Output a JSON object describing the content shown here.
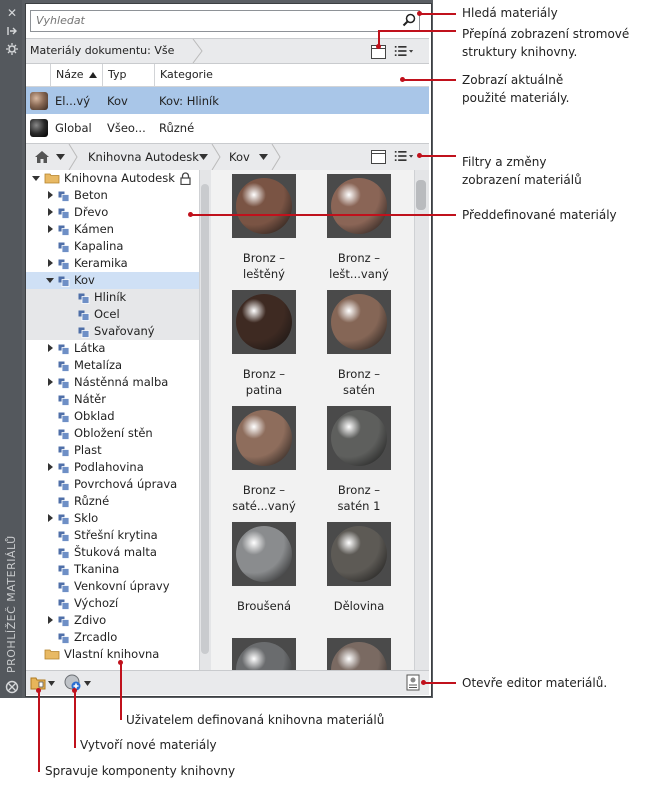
{
  "palette": {
    "vertical_title": "PROHLÍŽEČ MATERIÁLŮ",
    "search": {
      "placeholder": "Vyhledat"
    },
    "document_bar": {
      "breadcrumb": "Materiály dokumentu: Vše"
    },
    "table": {
      "headers": [
        "Náze",
        "Typ",
        "Kategorie"
      ],
      "sort_indicator": "ascending",
      "rows": [
        {
          "name": "El...vý",
          "type": "Kov",
          "category": "Kov: Hliník",
          "selected": true,
          "swatch": "#8a6a55"
        },
        {
          "name": "Global",
          "type": "Všeo...",
          "category": "Různé",
          "selected": false,
          "swatch": "#2a2a2a"
        }
      ]
    },
    "library_bar": {
      "home_icon": "home-icon",
      "crumbs": [
        "Knihovna Autodesk",
        "Kov"
      ]
    },
    "tree": {
      "root": "Knihovna Autodesk",
      "items": [
        {
          "label": "Beton",
          "has_children": true
        },
        {
          "label": "Dřevo",
          "has_children": true
        },
        {
          "label": "Kámen",
          "has_children": true
        },
        {
          "label": "Kapalina",
          "has_children": false
        },
        {
          "label": "Keramika",
          "has_children": true
        },
        {
          "label": "Kov",
          "has_children": true,
          "expanded": true,
          "selected": true
        },
        {
          "label": "Hliník",
          "child": true
        },
        {
          "label": "Ocel",
          "child": true
        },
        {
          "label": "Svařovaný",
          "child": true
        },
        {
          "label": "Látka",
          "has_children": true
        },
        {
          "label": "Metalíza",
          "has_children": false
        },
        {
          "label": "Nástěnná malba",
          "has_children": true
        },
        {
          "label": "Nátěr",
          "has_children": false
        },
        {
          "label": "Obklad",
          "has_children": false
        },
        {
          "label": "Obložení stěn",
          "has_children": false
        },
        {
          "label": "Plast",
          "has_children": false
        },
        {
          "label": "Podlahovina",
          "has_children": true
        },
        {
          "label": "Povrchová úprava",
          "has_children": false
        },
        {
          "label": "Různé",
          "has_children": false
        },
        {
          "label": "Sklo",
          "has_children": true
        },
        {
          "label": "Střešní krytina",
          "has_children": false
        },
        {
          "label": "Štuková malta",
          "has_children": false
        },
        {
          "label": "Tkanina",
          "has_children": false
        },
        {
          "label": "Venkovní úpravy",
          "has_children": false
        },
        {
          "label": "Výchozí",
          "has_children": false
        },
        {
          "label": "Zdivo",
          "has_children": true
        },
        {
          "label": "Zrcadlo",
          "has_children": false
        }
      ],
      "custom_library": "Vlastní knihovna"
    },
    "materials": [
      {
        "line1": "Bronz –",
        "line2": "leštěný",
        "color": "#7a5444"
      },
      {
        "line1": "Bronz –",
        "line2": "lešt...vaný",
        "color": "#8a6556"
      },
      {
        "line1": "Bronz –",
        "line2": "patina",
        "color": "#3e2a22"
      },
      {
        "line1": "Bronz –",
        "line2": "satén",
        "color": "#856656"
      },
      {
        "line1": "Bronz –",
        "line2": "saté...vaný",
        "color": "#8e6d5c"
      },
      {
        "line1": "Bronz –",
        "line2": "satén 1",
        "color": "#5e5f5d"
      },
      {
        "line1": "Broušená",
        "line2": "",
        "color": "#8a8c8e"
      },
      {
        "line1": "Dělovina",
        "line2": "",
        "color": "#5d5a55"
      },
      {
        "line1": "",
        "line2": "",
        "color": "#6a6c6e"
      },
      {
        "line1": "",
        "line2": "",
        "color": "#7a6a62"
      }
    ]
  },
  "annotations": {
    "search": "Hledá materiály",
    "tree_toggle_1": "Přepíná zobrazení stromové",
    "tree_toggle_2": "struktury knihovny.",
    "current_1": "Zobrazí aktuálně",
    "current_2": "použité materiály.",
    "filters_1": "Filtry a změny",
    "filters_2": "zobrazení materiálů",
    "predefined": "Předdefinované materiály",
    "editor": "Otevře editor materiálů.",
    "user_library": "Uživatelem definovaná knihovna materiálů",
    "create": "Vytvoří nové materiály",
    "manage": "Spravuje komponenty knihovny"
  }
}
